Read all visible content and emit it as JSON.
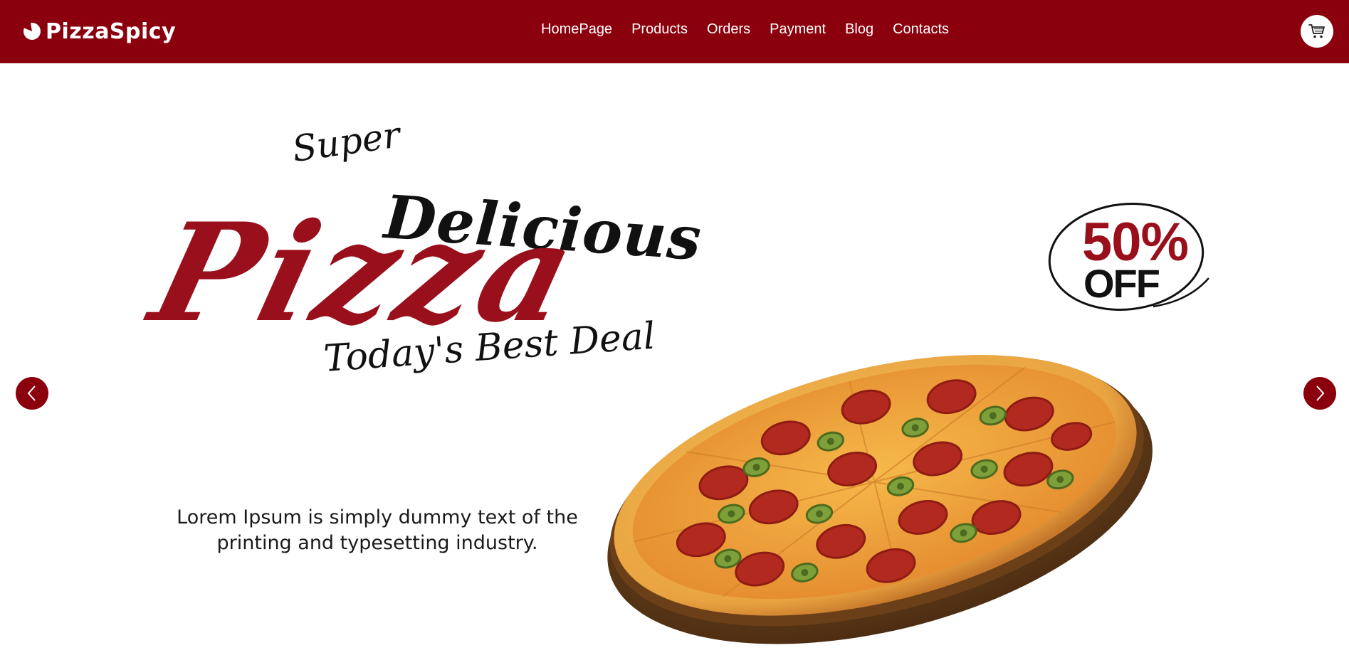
{
  "brand": {
    "name": "PizzaSpicy",
    "logo_icon": "pizza-slice-icon",
    "color": "#8b000d"
  },
  "nav": {
    "items": [
      {
        "label": "HomePage"
      },
      {
        "label": "Products"
      },
      {
        "label": "Orders"
      },
      {
        "label": "Payment"
      },
      {
        "label": "Blog"
      },
      {
        "label": "Contacts"
      }
    ],
    "cart_icon": "shopping-cart-icon"
  },
  "hero": {
    "headline_top": "Super",
    "headline_accent": "Delicious",
    "headline_main": "Pizza",
    "headline_sub": "Today's Best Deal",
    "description": "Lorem Ipsum is simply dummy text of the printing and typesetting industry.",
    "badge_percent": "50%",
    "badge_label": "OFF",
    "accent_color": "#9a0f1c",
    "prev_icon": "chevron-left-icon",
    "next_icon": "chevron-right-icon",
    "image": "pepperoni-jalapeno-pizza"
  }
}
